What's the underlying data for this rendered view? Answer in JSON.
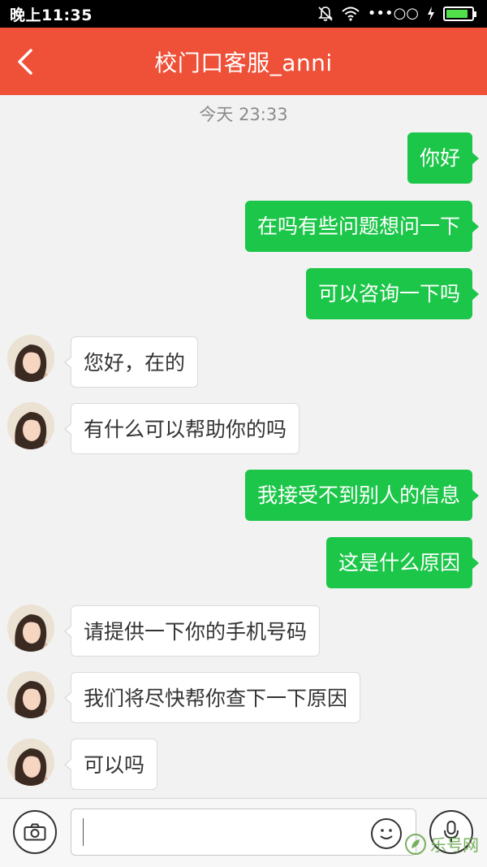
{
  "status_bar": {
    "time": "晚上11:35",
    "signal_text": "•••○○",
    "battery_level": 0.85,
    "icons": [
      "bell-off-icon",
      "wifi-icon",
      "signal-icon",
      "charging-icon",
      "battery-icon"
    ]
  },
  "nav": {
    "title": "校门口客服_anni",
    "back_icon": "chevron-left-icon"
  },
  "chat": {
    "timestamp": "今天 23:33",
    "messages": [
      {
        "direction": "out",
        "text": "你好"
      },
      {
        "direction": "out",
        "text": "在吗有些问题想问一下"
      },
      {
        "direction": "out",
        "text": "可以咨询一下吗"
      },
      {
        "direction": "in",
        "text": "您好，在的"
      },
      {
        "direction": "in",
        "text": "有什么可以帮助你的吗"
      },
      {
        "direction": "out",
        "text": "我接受不到别人的信息"
      },
      {
        "direction": "out",
        "text": "这是什么原因"
      },
      {
        "direction": "in",
        "text": "请提供一下你的手机号码"
      },
      {
        "direction": "in",
        "text": "我们将尽快帮你查下一下原因"
      },
      {
        "direction": "in",
        "text": "可以吗"
      }
    ]
  },
  "input_bar": {
    "value": "",
    "placeholder": "",
    "icons": [
      "camera-icon",
      "emoji-icon",
      "microphone-icon"
    ]
  },
  "watermark": {
    "text": "乐号网"
  },
  "colors": {
    "nav_bg": "#ee5038",
    "outgoing_bubble": "#1cc649",
    "incoming_bubble": "#ffffff",
    "page_bg": "#f2f2f2"
  }
}
